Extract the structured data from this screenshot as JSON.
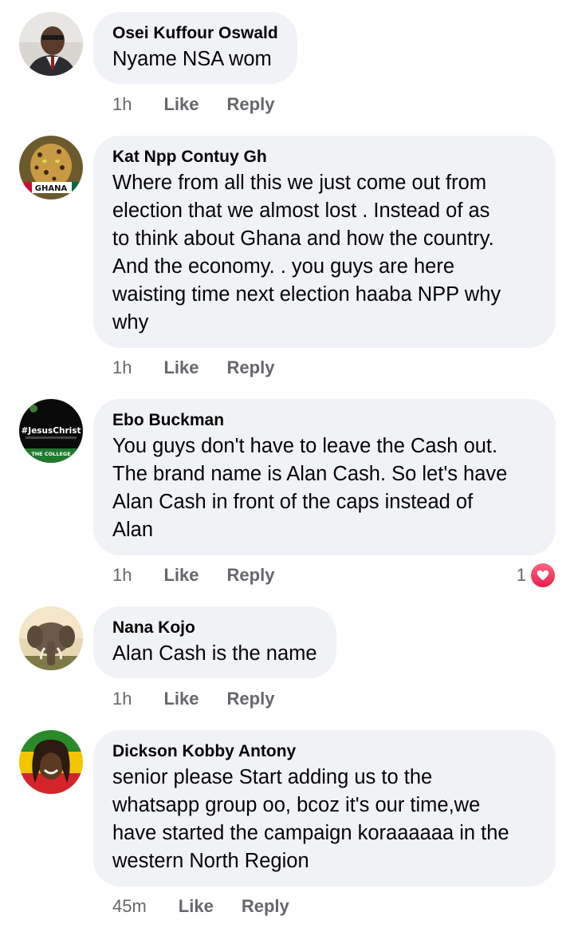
{
  "colors": {
    "bubble": "#f0f2f5",
    "meta": "#65676b",
    "text": "#050505",
    "love": "#f33e58"
  },
  "comments": [
    {
      "author": "Osei Kuffour Oswald",
      "text": "Nyame NSA wom",
      "time": "1h",
      "like": "Like",
      "reply": "Reply",
      "avatar": "profile-photo-man-suit"
    },
    {
      "author": "Kat Npp Contuy Gh",
      "text": "Where from all this we just come out from\nelection that we almost lost . Instead of as\nto think about Ghana and how the country.\nAnd the  economy. . you guys are here\nwaisting time  next election haaba NPP why\nwhy",
      "time": "1h",
      "like": "Like",
      "reply": "Reply",
      "avatar": "leopard-ghana-photo",
      "avatar_text": "GHANA"
    },
    {
      "author": "Ebo Buckman",
      "text": "You guys don't have to leave the Cash out.\nThe brand name is Alan Cash. So let's have\nAlan Cash in front of the caps instead of\nAlan",
      "time": "1h",
      "like": "Like",
      "reply": "Reply",
      "avatar": "jesuschrist-college-badge",
      "avatar_text": "#JesusChrist",
      "avatar_text2": "THE COLLEGE",
      "reaction_count": "1",
      "reaction_icon": "love-heart-icon"
    },
    {
      "author": "Nana Kojo",
      "text": "Alan Cash is the name",
      "time": "1h",
      "like": "Like",
      "reply": "Reply",
      "avatar": "elephant-photo"
    },
    {
      "author": "Dickson Kobby Antony",
      "text": "senior please Start adding us to the\nwhatsapp group oo, bcoz it's our time,we\nhave started the campaign koraaaaaa in the\nwestern North Region",
      "time": "45m",
      "like": "Like",
      "reply": "Reply",
      "avatar": "reggae-singer-photo"
    }
  ]
}
